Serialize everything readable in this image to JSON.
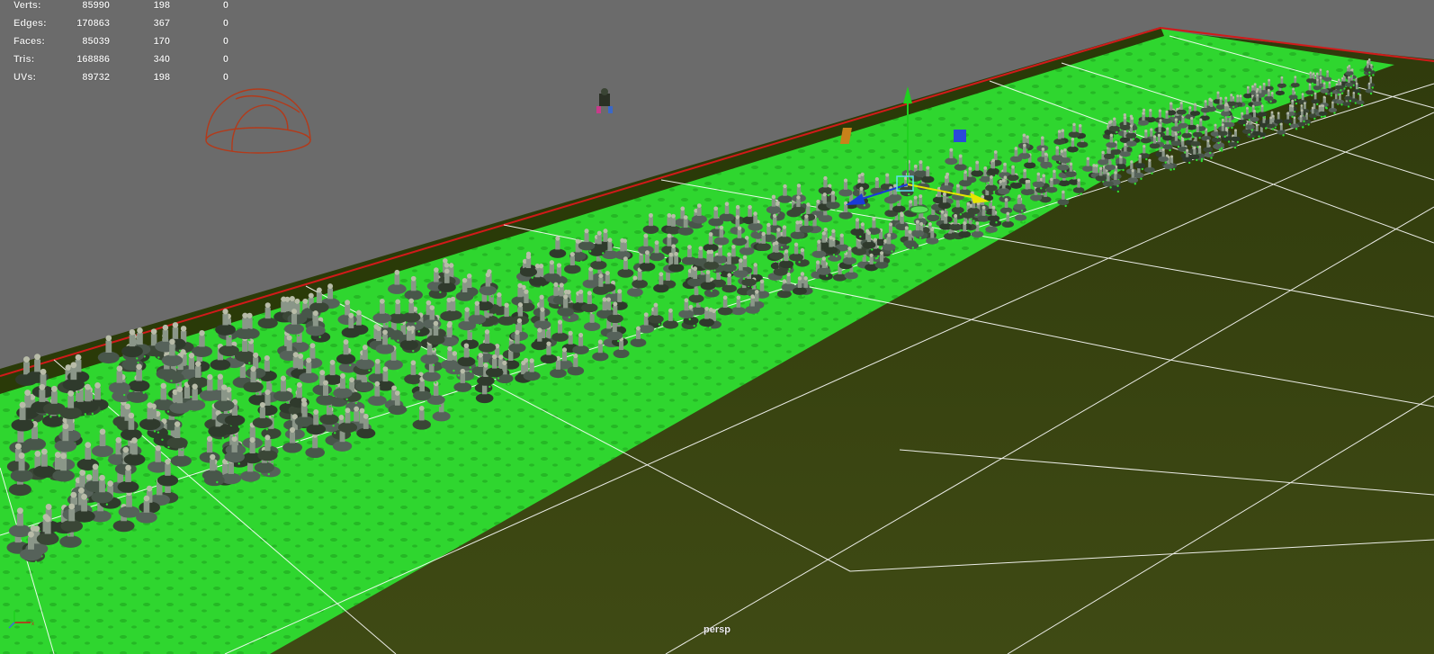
{
  "stats": {
    "rows": [
      {
        "label": "Verts:",
        "v1": "85990",
        "v2": "198",
        "v3": "0"
      },
      {
        "label": "Edges:",
        "v1": "170863",
        "v2": "367",
        "v3": "0"
      },
      {
        "label": "Faces:",
        "v1": "85039",
        "v2": "170",
        "v3": "0"
      },
      {
        "label": "Tris:",
        "v1": "168886",
        "v2": "340",
        "v3": "0"
      },
      {
        "label": "UVs:",
        "v1": "89732",
        "v2": "198",
        "v3": "0"
      }
    ]
  },
  "viewport": {
    "camera_label": "persp",
    "colors": {
      "background": "#6b6b6b",
      "ground": "#3b4410",
      "highlight_plane": "#2fd62f",
      "grid_line": "#ffffff",
      "border_red": "#d11a1a",
      "gizmo_x": "#e6e600",
      "gizmo_y": "#1fd11f",
      "gizmo_z": "#1a3ad9",
      "light_dome": "#b33a1a",
      "crowd": "#3d4a3a"
    },
    "icons": {
      "dome_light": "hemisphere-light-icon",
      "manipulator": "move-manipulator-icon",
      "axis": "view-axis-icon"
    }
  }
}
